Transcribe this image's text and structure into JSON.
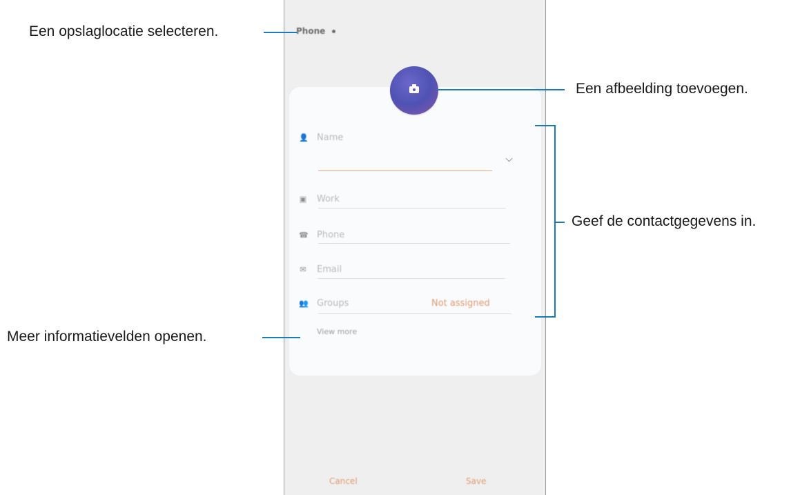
{
  "annotations": {
    "storage": "Een opslaglocatie selecteren.",
    "image": "Een afbeelding toevoegen.",
    "details": "Geef de contactgegevens in.",
    "more_fields": "Meer informatievelden openen."
  },
  "header": {
    "storage_location": "Phone"
  },
  "form": {
    "name_label": "Name",
    "work_label": "Work",
    "phone_label": "Phone",
    "email_label": "Email",
    "groups_label": "Groups",
    "groups_value": "Not assigned",
    "view_more": "View more"
  },
  "footer": {
    "cancel": "Cancel",
    "save": "Save"
  },
  "colors": {
    "accent": "#e59a72",
    "callout_line": "#1b7bb8",
    "avatar": "#5b59be"
  }
}
